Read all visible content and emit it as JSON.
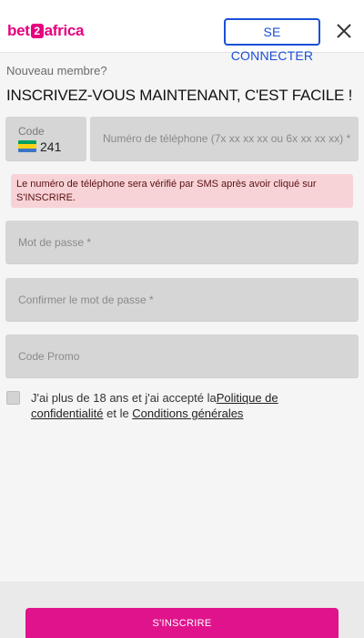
{
  "header": {
    "logo_left": "bet",
    "logo_mid": "2",
    "logo_right": "africa",
    "connect_label": "SE CONNECTER",
    "close_icon": "close-icon"
  },
  "form": {
    "subtitle": "Nouveau membre?",
    "title": "INSCRIVEZ-VOUS MAINTENANT, C'EST FACILE !",
    "code_label": "Code",
    "code_value": "241",
    "flag_icon": "gabon-flag-icon",
    "phone_placeholder": "Numéro de téléphone (7x xx xx xx ou 6x xx xx xx) *",
    "sms_notice": "Le numéro de téléphone sera vérifié par SMS après avoir cliqué sur S'INSCRIRE.",
    "password_placeholder": "Mot de passe *",
    "confirm_placeholder": "Confirmer le mot de passe *",
    "promo_placeholder": "Code Promo",
    "terms_prefix": "J'ai plus de 18 ans et j'ai accepté la",
    "privacy_link": "Politique de confidentialité",
    "terms_mid": " et le ",
    "conditions_link": "Conditions générales"
  },
  "footer": {
    "signup_label": "S'INSCRIRE"
  },
  "colors": {
    "brand": "#e6007e",
    "button": "#e0138c",
    "connect": "#1a4fd6",
    "notice_bg": "#f7d3d7"
  }
}
